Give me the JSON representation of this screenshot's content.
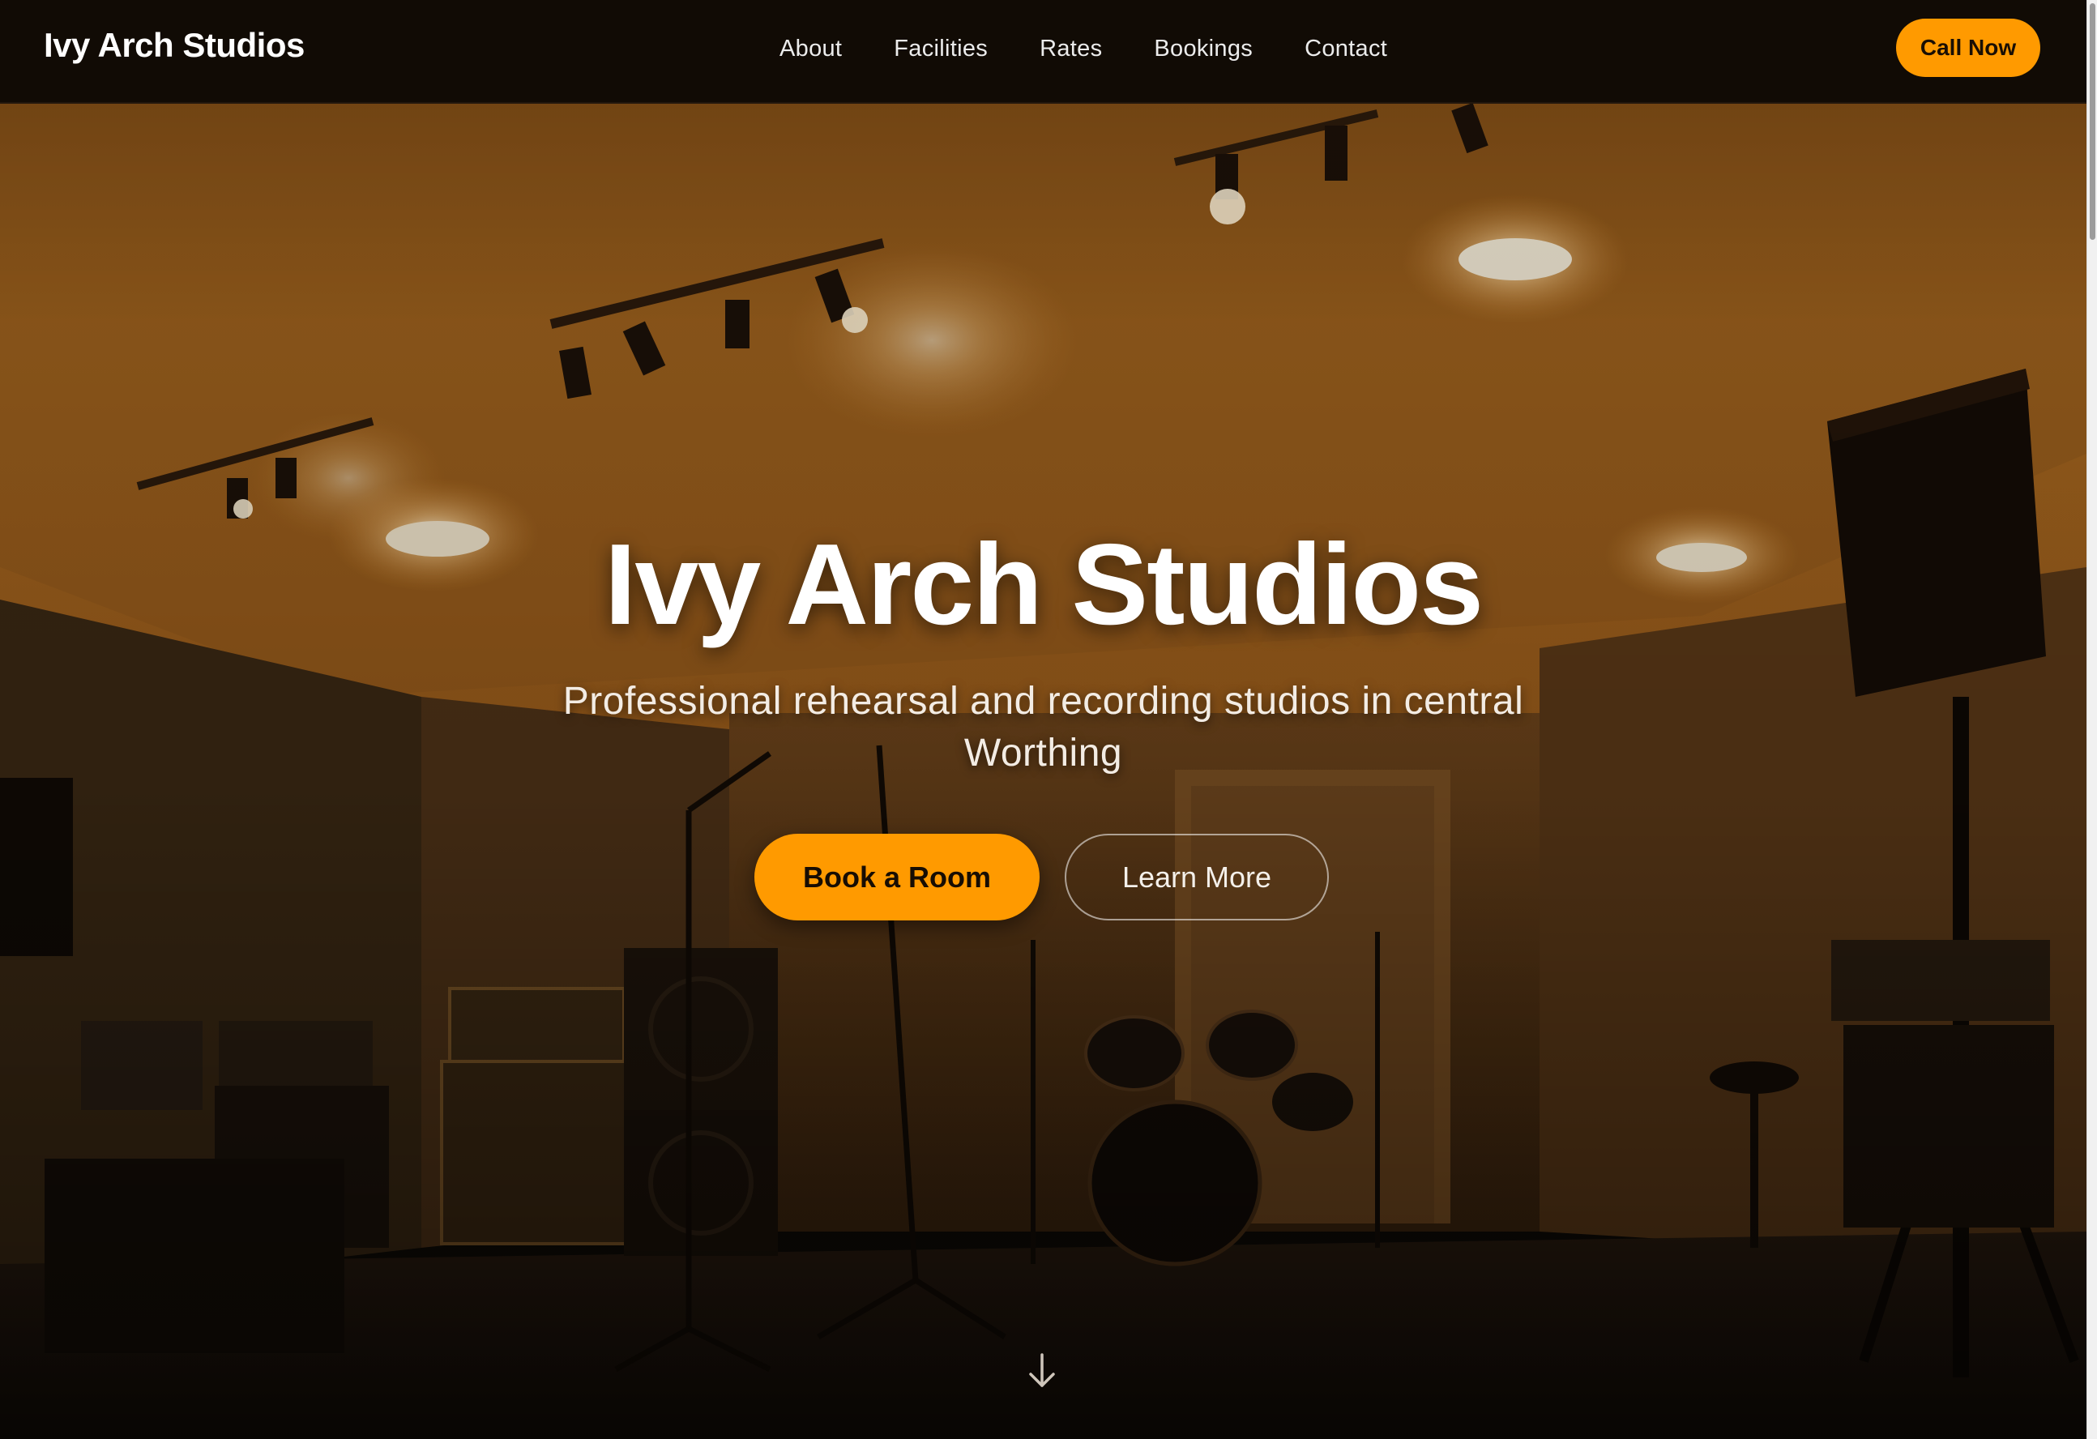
{
  "nav": {
    "brand": "Ivy Arch Studios",
    "links": [
      "About",
      "Facilities",
      "Rates",
      "Bookings",
      "Contact"
    ],
    "cta": "Call Now"
  },
  "hero": {
    "title": "Ivy Arch Studios",
    "subtitle": "Professional rehearsal and recording studios in central Worthing",
    "primary_button": "Book a Room",
    "secondary_button": "Learn More",
    "scroll_icon": "arrow-down-icon",
    "background": "rehearsal studio room with amps, drum kit, mic stands, PA speakers and ceiling spotlights"
  },
  "colors": {
    "accent": "#ff9a00",
    "nav_bg": "#0e0905",
    "text_light": "#ffffff"
  }
}
